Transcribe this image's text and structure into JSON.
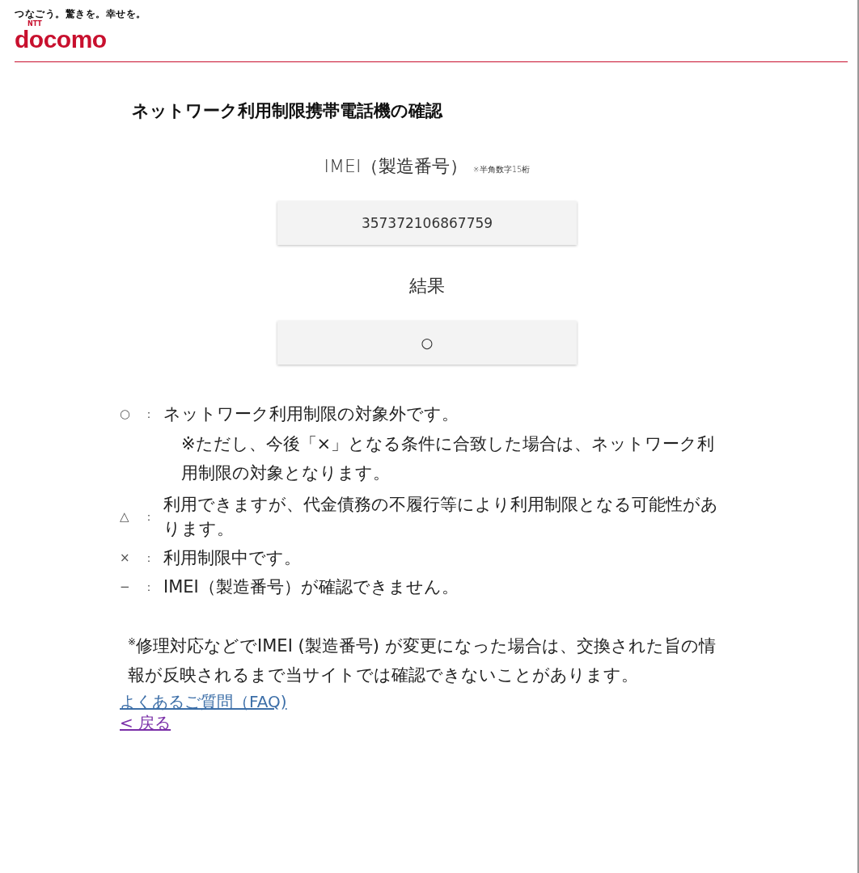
{
  "header": {
    "tagline": "つなごう。驚きを。幸せを。",
    "logo_small": "NTT",
    "logo": "docomo"
  },
  "title": "ネットワーク利用制限携帯電話機の確認",
  "imei": {
    "label": "IMEI（製造番号）",
    "hint": "※半角数字15桁",
    "value": "357372106867759"
  },
  "result": {
    "label": "結果",
    "value": "○"
  },
  "legend": [
    {
      "symbol": "○",
      "separator": "：",
      "text": "ネットワーク利用制限の対象外です。",
      "note": "※ただし、今後「×」となる条件に合致した場合は、ネットワーク利用制限の対象となります。"
    },
    {
      "symbol": "△",
      "separator": "：",
      "text": "利用できますが、代金債務の不履行等により利用制限となる可能性があります。"
    },
    {
      "symbol": "×",
      "separator": "：",
      "text": "利用制限中です。"
    },
    {
      "symbol": "−",
      "separator": "：",
      "text": "IMEI（製造番号）が確認できません。"
    }
  ],
  "footnote": "$^{※}$修理対応などでIMEI (製造番号) が変更になった場合は、交換された旨の情報が反映されるまで当サイトでは確認できないことがあります。",
  "links": [
    {
      "text": "よくあるご質問（FAQ)",
      "visited": false
    },
    {
      "text": "< 戻る",
      "visited": true
    }
  ]
}
